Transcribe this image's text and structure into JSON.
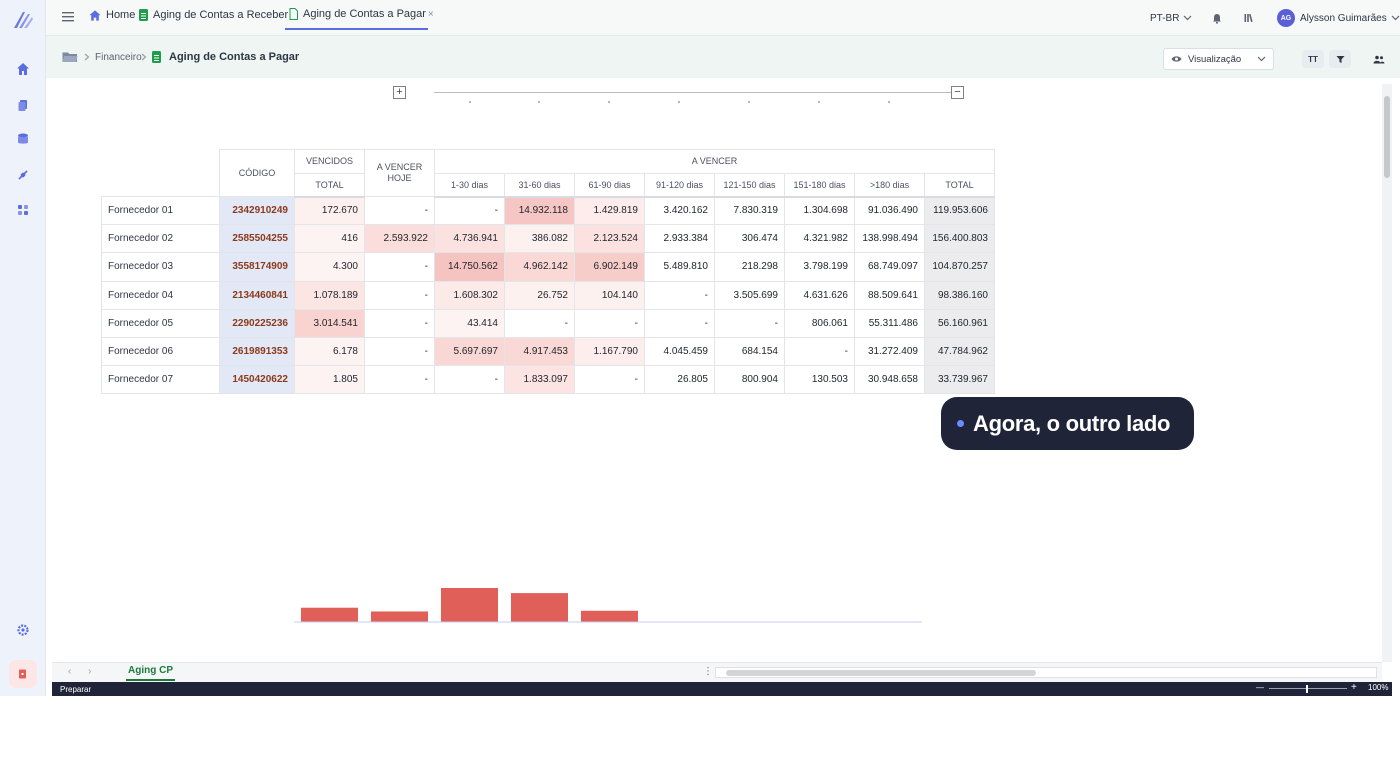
{
  "topbar": {
    "tabs": [
      {
        "label": "Home"
      },
      {
        "label": "Aging de Contas a Receber"
      },
      {
        "label": "Aging de Contas a Pagar",
        "close": "×"
      }
    ],
    "language": "PT-BR",
    "user": {
      "initials": "AG",
      "name": "Alysson Guimarães"
    }
  },
  "breadcrumb": {
    "folder": "Financeiro",
    "title": "Aging de Contas a Pagar"
  },
  "toolbar": {
    "view_label": "Visualização",
    "text_tool": "TT"
  },
  "table": {
    "headers": {
      "codigo": "CÓDIGO",
      "vencidos": "VENCIDOS",
      "vencidos_total": "TOTAL",
      "a_vencer_hoje": "A VENCER HOJE",
      "a_vencer": "A VENCER",
      "buckets": [
        "1-30 dias",
        "31-60 dias",
        "61-90 dias",
        "91-120 dias",
        "121-150 dias",
        "151-180 dias",
        ">180 dias",
        "TOTAL"
      ]
    },
    "rows": [
      {
        "name": "Fornecedor 01",
        "code": "2342910249",
        "vencidos": "172.670",
        "hoje": "-",
        "b": [
          "-",
          "14.932.118",
          "1.429.819",
          "3.420.162",
          "7.830.319",
          "1.304.698",
          "91.036.490",
          "119.953.606"
        ]
      },
      {
        "name": "Fornecedor 02",
        "code": "2585504255",
        "vencidos": "416",
        "hoje": "2.593.922",
        "b": [
          "4.736.941",
          "386.082",
          "2.123.524",
          "2.933.384",
          "306.474",
          "4.321.982",
          "138.998.494",
          "156.400.803"
        ]
      },
      {
        "name": "Fornecedor 03",
        "code": "3558174909",
        "vencidos": "4.300",
        "hoje": "-",
        "b": [
          "14.750.562",
          "4.962.142",
          "6.902.149",
          "5.489.810",
          "218.298",
          "3.798.199",
          "68.749.097",
          "104.870.257"
        ]
      },
      {
        "name": "Fornecedor 04",
        "code": "2134460841",
        "vencidos": "1.078.189",
        "hoje": "-",
        "b": [
          "1.608.302",
          "26.752",
          "104.140",
          "-",
          "3.505.699",
          "4.631.626",
          "88.509.641",
          "98.386.160"
        ]
      },
      {
        "name": "Fornecedor 05",
        "code": "2290225236",
        "vencidos": "3.014.541",
        "hoje": "-",
        "b": [
          "43.414",
          "-",
          "-",
          "-",
          "-",
          "806.061",
          "55.311.486",
          "56.160.961"
        ]
      },
      {
        "name": "Fornecedor 06",
        "code": "2619891353",
        "vencidos": "6.178",
        "hoje": "-",
        "b": [
          "5.697.697",
          "4.917.453",
          "1.167.790",
          "4.045.459",
          "684.154",
          "-",
          "31.272.409",
          "47.784.962"
        ]
      },
      {
        "name": "Fornecedor 07",
        "code": "1450420622",
        "vencidos": "1.805",
        "hoje": "-",
        "b": [
          "-",
          "1.833.097",
          "-",
          "26.805",
          "800.904",
          "130.503",
          "30.948.658",
          "33.739.967"
        ]
      }
    ]
  },
  "tooltip": {
    "text": "Agora, o outro lado"
  },
  "chart_data": {
    "type": "bar",
    "values": [
      0.42,
      0.31,
      1.0,
      0.85,
      0.33
    ],
    "color": "#e05f59"
  },
  "sheets": {
    "active": "Aging CP"
  },
  "status": {
    "mode": "Preparar",
    "zoom": "100%",
    "minus": "—",
    "plus": "+"
  },
  "colors": {
    "accent": "#5b6ee1",
    "heat": "#e05f59",
    "code_text": "#8b3a1a"
  }
}
